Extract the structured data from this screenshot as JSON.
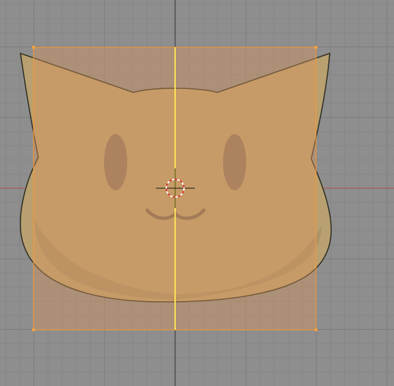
{
  "viewport": {
    "background_color": "#8e8e8e",
    "grid_minor_color": "#868686",
    "grid_major_color": "#7c7c7c",
    "x_axis_color": "#b04a40",
    "y_axis_color": "#3e3e44"
  },
  "reference_image": {
    "subject": "cat-face",
    "face_fill": "#b8a070",
    "face_outline": "#2f2f24",
    "eye_color": "#8e7562",
    "mouth_color": "#7d6a55"
  },
  "selection_plane": {
    "fill": "#d9935a",
    "fill_opacity": 0.42,
    "edge_color": "#f09a3c",
    "vertex_color": "#f5a23e",
    "center_edge_color": "#ffe455"
  },
  "cursor": {
    "ring_color_a": "#d8382c",
    "ring_color_b": "#ffffff",
    "crosshair_color": "#111111"
  }
}
